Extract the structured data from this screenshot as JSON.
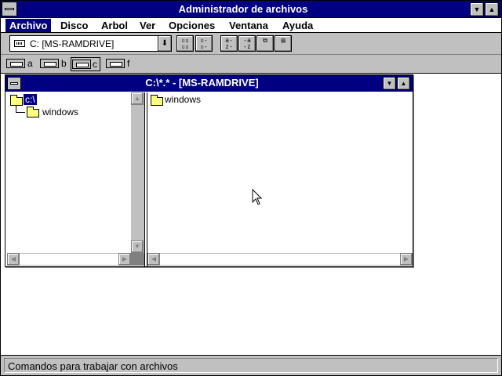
{
  "window": {
    "title": "Administrador de archivos"
  },
  "menu": [
    "Archivo",
    "Disco",
    "Arbol",
    "Ver",
    "Opciones",
    "Ventana",
    "Ayuda"
  ],
  "toolbar": {
    "drive_combo": "C: [MS-RAMDRIVE]",
    "tools": [
      "view-tree-dir-icon",
      "view-dir-only-icon",
      "sort-name-icon",
      "sort-type-icon",
      "copy-icon",
      "properties-icon"
    ]
  },
  "drives": [
    {
      "letter": "a",
      "kind": "floppy"
    },
    {
      "letter": "b",
      "kind": "floppy"
    },
    {
      "letter": "c",
      "kind": "ramdrive",
      "selected": true
    },
    {
      "letter": "f",
      "kind": "network"
    }
  ],
  "child": {
    "title": "C:\\*.* - [MS-RAMDRIVE]",
    "tree": {
      "root": "c:\\",
      "children": [
        "windows"
      ]
    },
    "files": [
      "windows"
    ]
  },
  "status": {
    "text": "Comandos para trabajar con archivos"
  },
  "colors": {
    "titlebar": "#000080",
    "face": "#c0c0c0",
    "folder": "#ffff80"
  }
}
